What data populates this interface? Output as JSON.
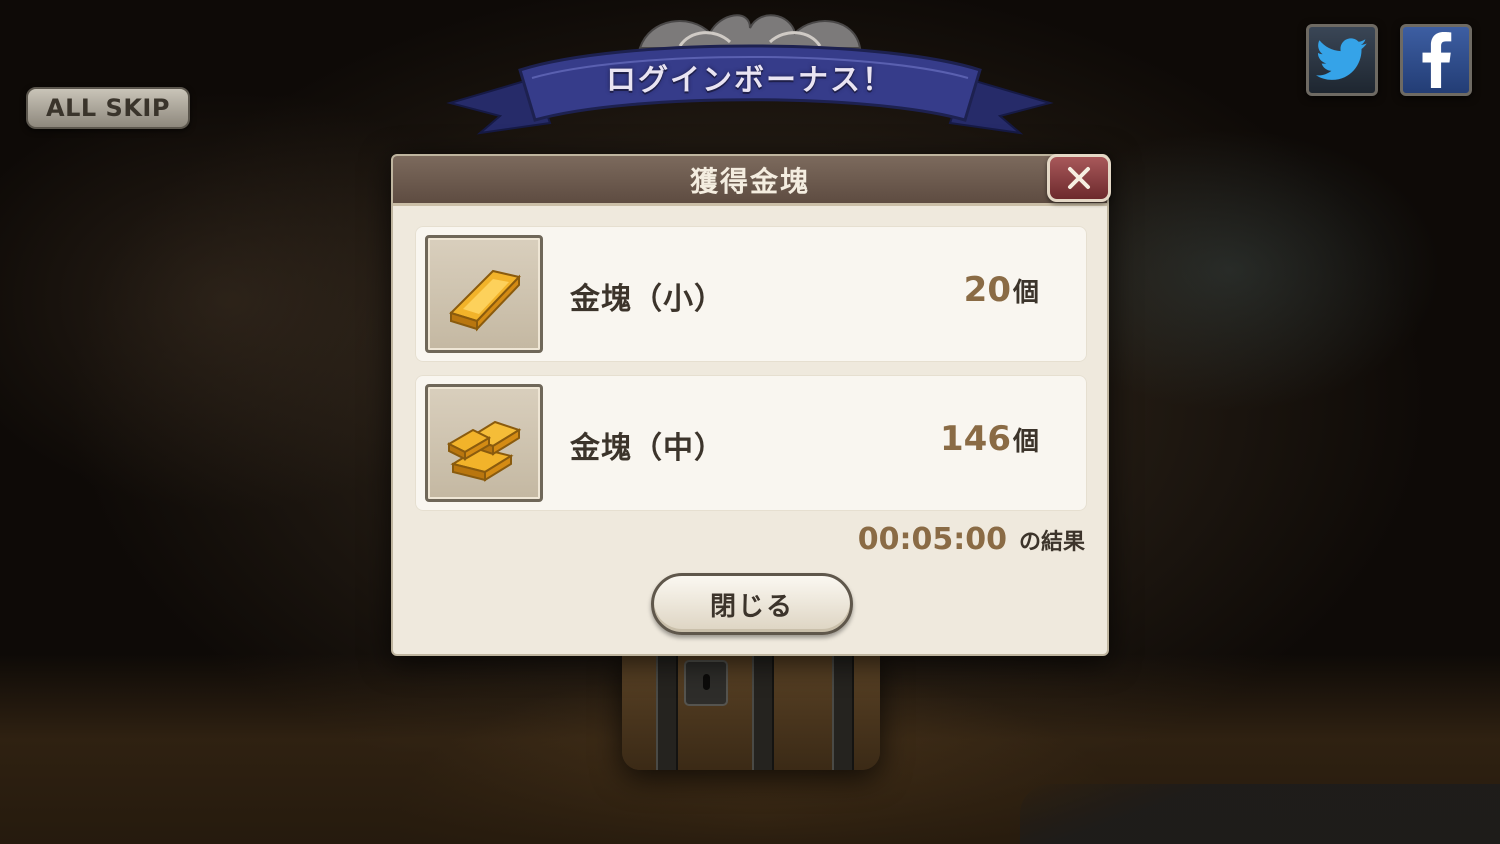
{
  "top_bar": {
    "all_skip_label": "ALL SKIP",
    "banner_title": "ログインボーナス！",
    "twitter_icon": "twitter-bird-icon",
    "facebook_icon": "facebook-f-icon"
  },
  "dialog": {
    "title": "獲得金塊",
    "close_icon": "close-x-icon",
    "items": [
      {
        "name": "金塊（小）",
        "quantity": "20",
        "unit": "個",
        "icon": "gold-bar-single-icon"
      },
      {
        "name": "金塊（中）",
        "quantity": "146",
        "unit": "個",
        "icon": "gold-bar-stack-icon"
      }
    ],
    "elapsed_time": "00:05:00",
    "elapsed_suffix": "の結果",
    "close_button_label": "閉じる"
  },
  "colors": {
    "dialog_bg": "#efe9dd",
    "header_bg": "#6e5c4f",
    "quantity_text": "#8a6b45",
    "banner_ribbon": "#363c8a",
    "close_btn": "#8c3f42"
  }
}
